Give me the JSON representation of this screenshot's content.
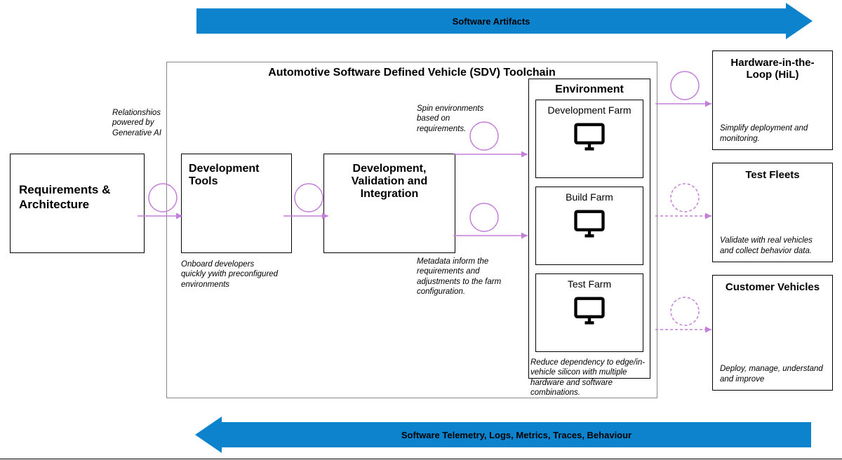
{
  "topArrow": "Software Artifacts",
  "bottomArrow": "Software Telemetry, Logs, Metrics, Traces, Behaviour",
  "mainTitle": "Automotive Software Defined Vehicle (SDV) Toolchain",
  "boxes": {
    "requirements": "Requirements & Architecture",
    "devTools": "Development Tools",
    "dvi": "Development, Validation and Integration",
    "environment": "Environment",
    "devFarm": "Development Farm",
    "buildFarm": "Build Farm",
    "testFarm": "Test Farm",
    "hil": "Hardware-in-the-Loop (HiL)",
    "testFleets": "Test Fleets",
    "customerVehicles": "Customer Vehicles"
  },
  "notes": {
    "genAI": "Relationshios powered by Generative AI",
    "onboard": "Onboard developers quickly ywith preconfigured environments",
    "spin": "Spin environments based on requirements.",
    "metadata": "Metadata inform the requirements and adjustments to the farm configuration.",
    "reduce": "Reduce dependency to edge/in-vehicle silicon with multiple hardware and software combinations.",
    "hilNote": "Simplify deployment and monitoring.",
    "fleetsNote": "Validate with real vehicles and collect behavior data.",
    "custNote": "Deploy, manage, understand and improve"
  }
}
